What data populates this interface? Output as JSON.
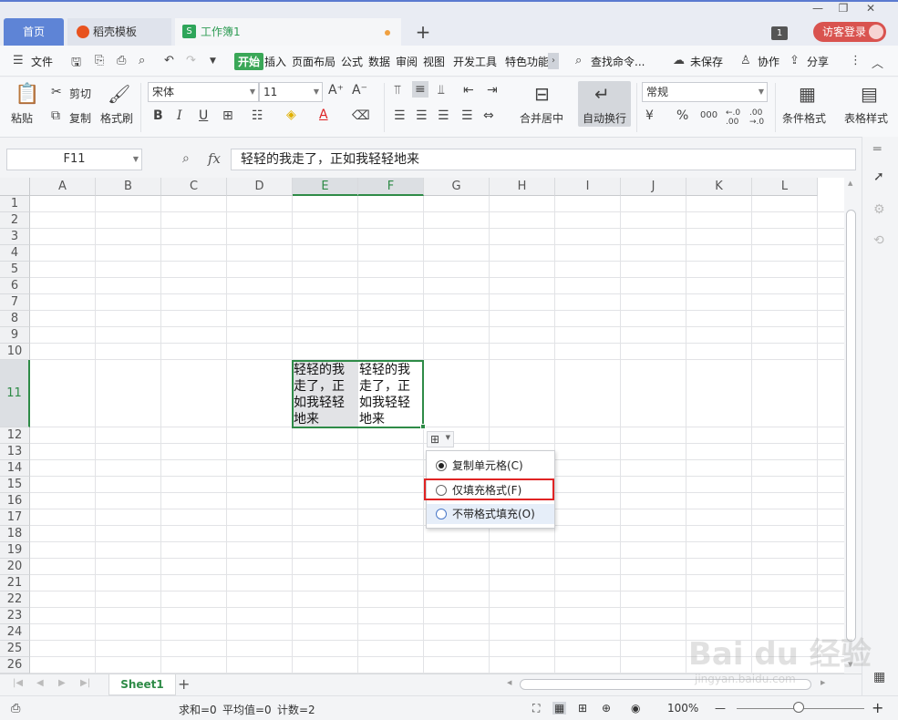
{
  "tabs": {
    "home": "首页",
    "template": "稻壳模板",
    "workbook": "工作簿1",
    "workbook_icon": "S",
    "add": "+"
  },
  "window": {
    "minimize": "—",
    "restore": "❐",
    "close": "✕",
    "badge": "1",
    "login": "访客登录"
  },
  "menu": {
    "items": [
      "文件",
      "开始",
      "插入",
      "页面布局",
      "公式",
      "数据",
      "审阅",
      "视图",
      "开发工具",
      "特色功能"
    ],
    "search": "查找命令...",
    "unsaved": "未保存",
    "collab": "协作",
    "share": "分享"
  },
  "ribbon": {
    "paste": "粘贴",
    "cut": "剪切",
    "copy": "复制",
    "format_painter": "格式刷",
    "font_name": "宋体",
    "font_size": "11",
    "merge_center": "合并居中",
    "auto_wrap": "自动换行",
    "number_format": "常规",
    "cond_format": "条件格式",
    "table_style": "表格样式",
    "bold": "B",
    "italic": "I",
    "underline": "U",
    "currency": "¥",
    "percent": "%",
    "thousands": "000",
    "inc_decimal": "←.0 .00",
    "dec_decimal": ".00 →.0"
  },
  "formula_bar": {
    "name_box": "F11",
    "fx": "fx",
    "content": "轻轻的我走了，正如我轻轻地来"
  },
  "grid": {
    "columns": [
      "A",
      "B",
      "C",
      "D",
      "E",
      "F",
      "G",
      "H",
      "I",
      "J",
      "K",
      "L"
    ],
    "rows": [
      "1",
      "2",
      "3",
      "4",
      "5",
      "6",
      "7",
      "8",
      "9",
      "10",
      "11",
      "12",
      "13",
      "14",
      "15",
      "16",
      "17",
      "18",
      "19",
      "20",
      "21",
      "22",
      "23",
      "24",
      "25",
      "26"
    ],
    "cell_e11": "轻轻的我走了，正如我轻轻地来",
    "cell_f11": "轻轻的我走了，正如我轻轻地来"
  },
  "fill_menu": {
    "options": [
      "复制单元格(C)",
      "仅填充格式(F)",
      "不带格式填充(O)"
    ],
    "selected_index": 0,
    "highlight_index": 2,
    "boxed_index": 1
  },
  "sheets": {
    "active": "Sheet1",
    "add": "+"
  },
  "status": {
    "sum": "求和=0",
    "avg": "平均值=0",
    "count": "计数=2",
    "zoom": "100%"
  },
  "watermark": {
    "main": "Bai du 经验",
    "sub": "jingyan.baidu.com"
  },
  "colors": {
    "accent_green": "#2e8b47",
    "highlight_red": "#e02424",
    "tab_blue": "#5e84d6"
  }
}
